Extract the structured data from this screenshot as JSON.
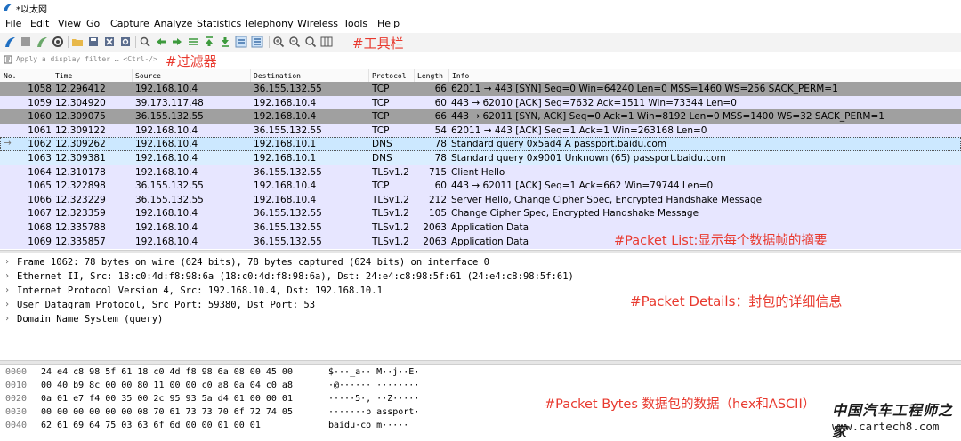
{
  "window": {
    "title": "*以太网"
  },
  "menu": {
    "items": [
      {
        "pre": "",
        "u": "F",
        "post": "ile"
      },
      {
        "pre": "",
        "u": "E",
        "post": "dit"
      },
      {
        "pre": "",
        "u": "V",
        "post": "iew"
      },
      {
        "pre": "",
        "u": "G",
        "post": "o"
      },
      {
        "pre": "",
        "u": "C",
        "post": "apture"
      },
      {
        "pre": "",
        "u": "A",
        "post": "nalyze"
      },
      {
        "pre": "",
        "u": "S",
        "post": "tatistics"
      },
      {
        "pre": "Telephon",
        "u": "y",
        "post": ""
      },
      {
        "pre": "",
        "u": "W",
        "post": "ireless"
      },
      {
        "pre": "",
        "u": "T",
        "post": "ools"
      },
      {
        "pre": "",
        "u": "H",
        "post": "elp"
      }
    ]
  },
  "annotations": {
    "toolbar": "#工具栏",
    "filter": "#过滤器",
    "packet_list": "#Packet List:显示每个数据帧的摘要",
    "packet_details": "#Packet Details：封包的详细信息",
    "packet_bytes": "#Packet Bytes 数据包的数据（hex和ASCII）"
  },
  "colors": {
    "tcp_syn": "#a0a0a0",
    "tcp_ack": "#e7e6ff",
    "dns": "#daeeff",
    "selected": "#cce8ff",
    "annotation": "#e8392e"
  },
  "filter": {
    "placeholder": "Apply a display filter … <Ctrl-/>"
  },
  "packet_list": {
    "columns": [
      "No.",
      "Time",
      "Source",
      "Destination",
      "Protocol",
      "Length",
      "Info"
    ],
    "rows": [
      {
        "no": "1058",
        "time": "12.296412",
        "src": "192.168.10.4",
        "dst": "36.155.132.55",
        "proto": "TCP",
        "len": "66",
        "info": "62011 → 443 [SYN] Seq=0 Win=64240 Len=0 MSS=1460 WS=256 SACK_PERM=1",
        "style": "dark"
      },
      {
        "no": "1059",
        "time": "12.304920",
        "src": "39.173.117.48",
        "dst": "192.168.10.4",
        "proto": "TCP",
        "len": "60",
        "info": "443 → 62010 [ACK] Seq=7632 Ack=1511 Win=73344 Len=0",
        "style": "tcp"
      },
      {
        "no": "1060",
        "time": "12.309075",
        "src": "36.155.132.55",
        "dst": "192.168.10.4",
        "proto": "TCP",
        "len": "66",
        "info": "443 → 62011 [SYN, ACK] Seq=0 Ack=1 Win=8192 Len=0 MSS=1400 WS=32 SACK_PERM=1",
        "style": "dark"
      },
      {
        "no": "1061",
        "time": "12.309122",
        "src": "192.168.10.4",
        "dst": "36.155.132.55",
        "proto": "TCP",
        "len": "54",
        "info": "62011 → 443 [ACK] Seq=1 Ack=1 Win=263168 Len=0",
        "style": "tcp"
      },
      {
        "no": "1062",
        "time": "12.309262",
        "src": "192.168.10.4",
        "dst": "192.168.10.1",
        "proto": "DNS",
        "len": "78",
        "info": "Standard query 0x5ad4 A passport.baidu.com",
        "style": "selected"
      },
      {
        "no": "1063",
        "time": "12.309381",
        "src": "192.168.10.4",
        "dst": "192.168.10.1",
        "proto": "DNS",
        "len": "78",
        "info": "Standard query 0x9001 Unknown (65) passport.baidu.com",
        "style": "dns"
      },
      {
        "no": "1064",
        "time": "12.310178",
        "src": "192.168.10.4",
        "dst": "36.155.132.55",
        "proto": "TLSv1.2",
        "len": "715",
        "info": "Client Hello",
        "style": "tcp"
      },
      {
        "no": "1065",
        "time": "12.322898",
        "src": "36.155.132.55",
        "dst": "192.168.10.4",
        "proto": "TCP",
        "len": "60",
        "info": "443 → 62011 [ACK] Seq=1 Ack=662 Win=79744 Len=0",
        "style": "tcp"
      },
      {
        "no": "1066",
        "time": "12.323229",
        "src": "36.155.132.55",
        "dst": "192.168.10.4",
        "proto": "TLSv1.2",
        "len": "212",
        "info": "Server Hello, Change Cipher Spec, Encrypted Handshake Message",
        "style": "tcp"
      },
      {
        "no": "1067",
        "time": "12.323359",
        "src": "192.168.10.4",
        "dst": "36.155.132.55",
        "proto": "TLSv1.2",
        "len": "105",
        "info": "Change Cipher Spec, Encrypted Handshake Message",
        "style": "tcp"
      },
      {
        "no": "1068",
        "time": "12.335788",
        "src": "192.168.10.4",
        "dst": "36.155.132.55",
        "proto": "TLSv1.2",
        "len": "2063",
        "info": "Application Data",
        "style": "tcp"
      },
      {
        "no": "1069",
        "time": "12.335857",
        "src": "192.168.10.4",
        "dst": "36.155.132.55",
        "proto": "TLSv1.2",
        "len": "2063",
        "info": "Application Data",
        "style": "tcp"
      }
    ]
  },
  "packet_details": {
    "lines": [
      "Frame 1062: 78 bytes on wire (624 bits), 78 bytes captured (624 bits) on interface 0",
      "Ethernet II, Src: 18:c0:4d:f8:98:6a (18:c0:4d:f8:98:6a), Dst: 24:e4:c8:98:5f:61 (24:e4:c8:98:5f:61)",
      "Internet Protocol Version 4, Src: 192.168.10.4, Dst: 192.168.10.1",
      "User Datagram Protocol, Src Port: 59380, Dst Port: 53",
      "Domain Name System (query)"
    ]
  },
  "packet_bytes": {
    "lines": [
      {
        "off": "0000",
        "hex": "24 e4 c8 98 5f 61 18 c0  4d f8 98 6a 08 00 45 00",
        "asc": "$···_a·· M··j··E·"
      },
      {
        "off": "0010",
        "hex": "00 40 b9 8c 00 00 80 11  00 00 c0 a8 0a 04 c0 a8",
        "asc": "·@······ ········"
      },
      {
        "off": "0020",
        "hex": "0a 01 e7 f4 00 35 00 2c  95 93 5a d4 01 00 00 01",
        "asc": "·····5·, ··Z·····"
      },
      {
        "off": "0030",
        "hex": "00 00 00 00 00 00 08 70  61 73 73 70 6f 72 74 05",
        "asc": "·······p assport·"
      },
      {
        "off": "0040",
        "hex": "62 61 69 64 75 03 63 6f  6d 00 00 01 00 01",
        "asc": "baidu·co m·····"
      }
    ]
  },
  "watermark": {
    "cn": "中国汽车工程师之家",
    "url": "www.cartech8.com"
  }
}
